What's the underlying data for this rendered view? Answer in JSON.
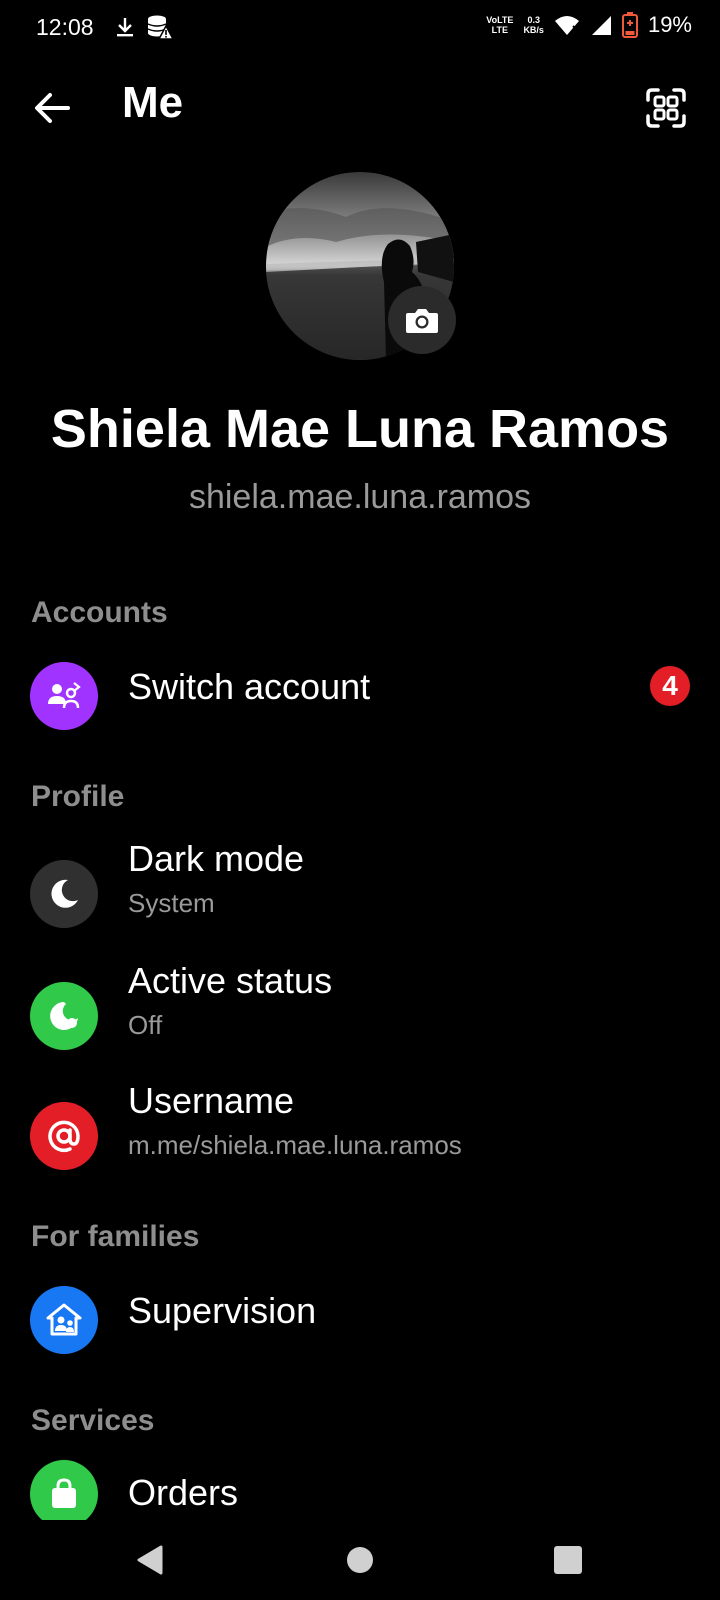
{
  "status_bar": {
    "time": "12:08",
    "network_type_top": "VoLTE",
    "network_type_bottom": "LTE",
    "data_rate_top": "0.3",
    "data_rate_bottom": "KB/s",
    "battery_percent": "19%",
    "battery_level_fraction": 0.19
  },
  "app_bar": {
    "title": "Me"
  },
  "profile": {
    "name": "Shiela Mae Luna Ramos",
    "handle": "shiela.mae.luna.ramos"
  },
  "sections": {
    "accounts": "Accounts",
    "profile": "Profile",
    "families": "For families",
    "services": "Services"
  },
  "items": {
    "switch_account": {
      "title": "Switch account",
      "badge": "4",
      "icon": "switch-account-icon",
      "color": "#a033ff"
    },
    "dark_mode": {
      "title": "Dark mode",
      "subtitle": "System",
      "icon": "moon-icon",
      "color": "#303030"
    },
    "active_status": {
      "title": "Active status",
      "subtitle": "Off",
      "icon": "active-status-icon",
      "color": "#31c94a"
    },
    "username": {
      "title": "Username",
      "subtitle": "m.me/shiela.mae.luna.ramos",
      "icon": "at-sign-icon",
      "color": "#e41e26"
    },
    "supervision": {
      "title": "Supervision",
      "icon": "supervision-icon",
      "color": "#1877f2"
    },
    "orders": {
      "title": "Orders",
      "icon": "shopping-bag-icon",
      "color": "#31c94a"
    }
  }
}
